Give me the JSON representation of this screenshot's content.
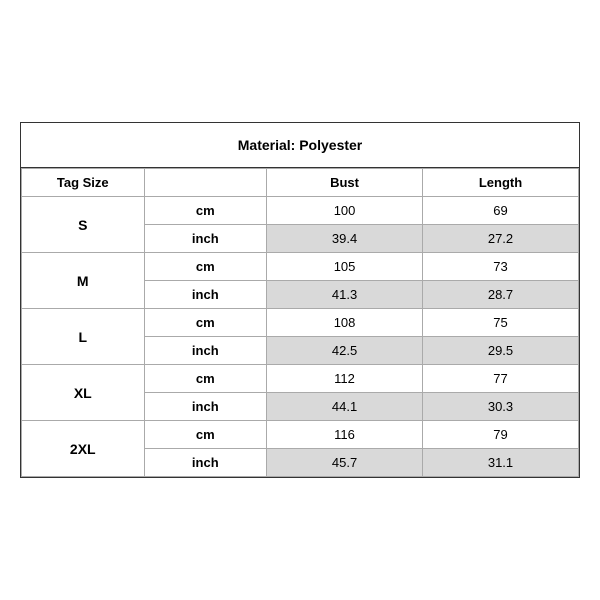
{
  "title": "Material: Polyester",
  "headers": {
    "tag_size": "Tag Size",
    "bust": "Bust",
    "length": "Length"
  },
  "sizes": [
    {
      "tag": "S",
      "cm": {
        "bust": "100",
        "length": "69"
      },
      "inch": {
        "bust": "39.4",
        "length": "27.2"
      }
    },
    {
      "tag": "M",
      "cm": {
        "bust": "105",
        "length": "73"
      },
      "inch": {
        "bust": "41.3",
        "length": "28.7"
      }
    },
    {
      "tag": "L",
      "cm": {
        "bust": "108",
        "length": "75"
      },
      "inch": {
        "bust": "42.5",
        "length": "29.5"
      }
    },
    {
      "tag": "XL",
      "cm": {
        "bust": "112",
        "length": "77"
      },
      "inch": {
        "bust": "44.1",
        "length": "30.3"
      }
    },
    {
      "tag": "2XL",
      "cm": {
        "bust": "116",
        "length": "79"
      },
      "inch": {
        "bust": "45.7",
        "length": "31.1"
      }
    }
  ],
  "units": {
    "cm": "cm",
    "inch": "inch"
  }
}
